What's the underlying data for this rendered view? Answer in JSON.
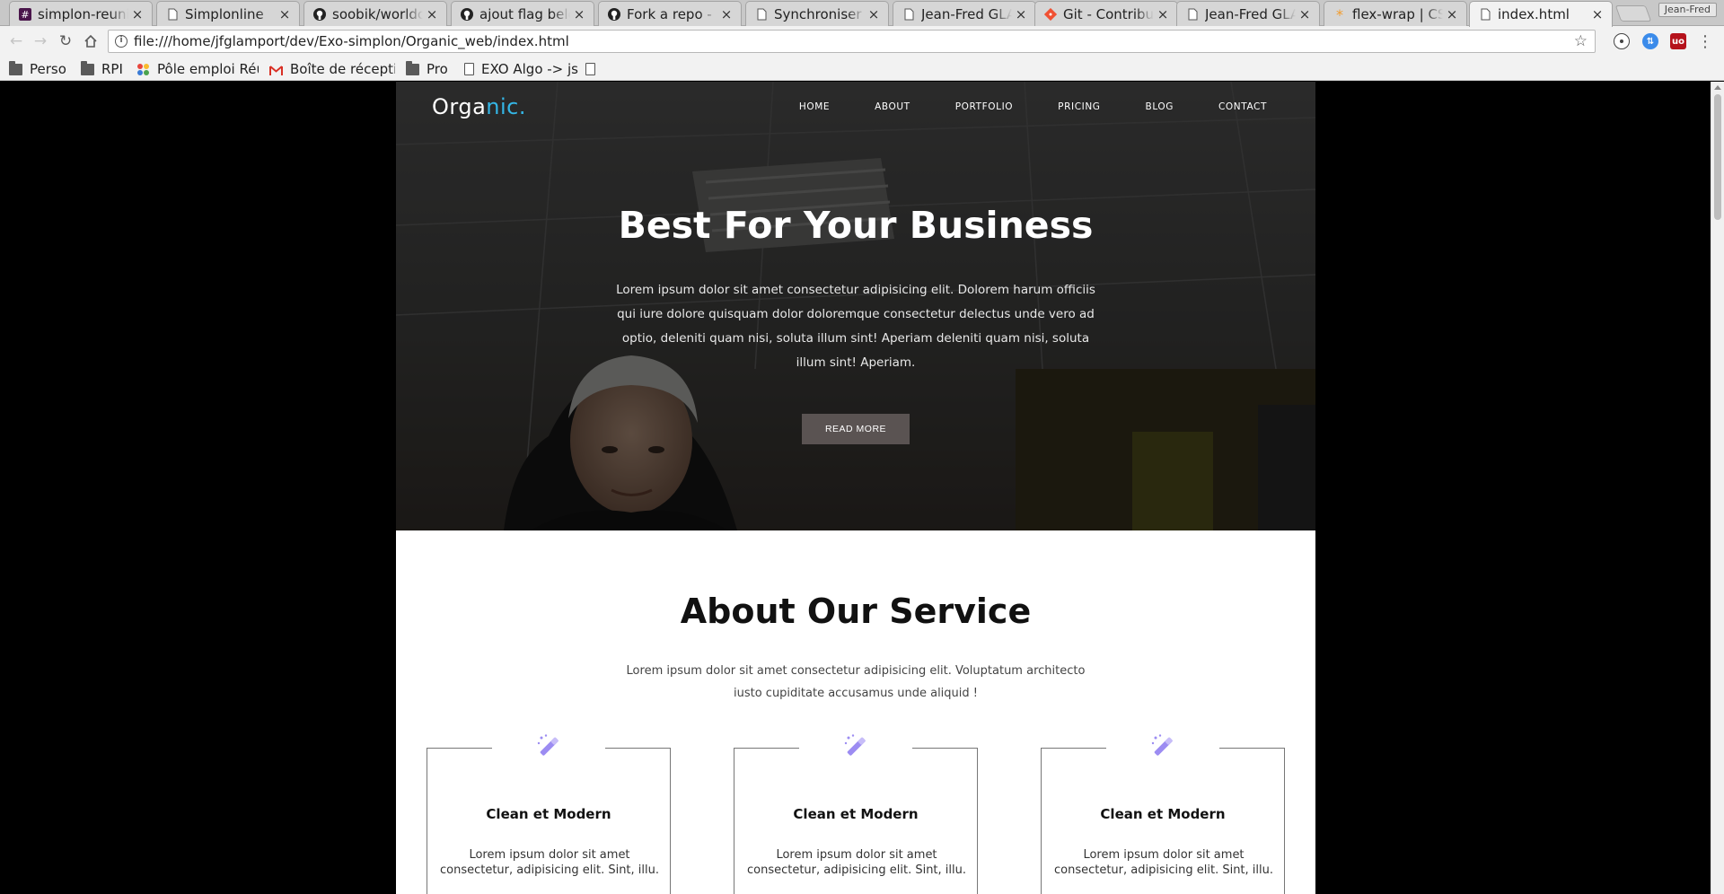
{
  "browser": {
    "tabs": [
      {
        "title": "simplon-reunion",
        "favicon": "slack-icon"
      },
      {
        "title": "Simplonline",
        "favicon": "page-icon"
      },
      {
        "title": "soobik/worldcountries",
        "favicon": "github-icon"
      },
      {
        "title": "ajout flag belgique",
        "favicon": "github-icon"
      },
      {
        "title": "Fork a repo - User Documentation",
        "favicon": "github-icon"
      },
      {
        "title": "Synchroniser son fork",
        "favicon": "page-icon"
      },
      {
        "title": "Jean-Fred GLAMPORT",
        "favicon": "page-icon"
      },
      {
        "title": "Git - Contributing",
        "favicon": "git-icon"
      },
      {
        "title": "Jean-Fred GLAMPORT",
        "favicon": "page-icon"
      },
      {
        "title": "flex-wrap | CSS-Tricks",
        "favicon": "csstricks-icon"
      },
      {
        "title": "index.html",
        "favicon": "page-icon",
        "active": true
      }
    ],
    "close_glyph": "×",
    "profile_name": "Jean-Fred",
    "url": "file:///home/jfglamport/dev/Exo-simplon/Organic_web/index.html",
    "bookmarks": [
      {
        "label": "Perso",
        "icon": "folder-icon"
      },
      {
        "label": "RPI",
        "icon": "folder-icon"
      },
      {
        "label": "Pôle emploi Réunion",
        "icon": "pinwheel-icon"
      },
      {
        "label": "Boîte de réception",
        "icon": "gmail-icon"
      },
      {
        "label": "Pro",
        "icon": "folder-icon"
      },
      {
        "label": "EXO Algo -> js",
        "icon": "page-icon"
      },
      {
        "label": "",
        "icon": "page-icon"
      }
    ]
  },
  "site": {
    "logo_main": "Orga",
    "logo_accent": "nic.",
    "nav": [
      "HOME",
      "ABOUT",
      "PORTFOLIO",
      "PRICING",
      "BLOG",
      "CONTACT"
    ],
    "hero": {
      "title": "Best For Your Business",
      "text": "Lorem ipsum dolor sit amet consectetur adipisicing elit. Dolorem harum officiis qui iure dolore quisquam dolor doloremque consectetur delectus unde vero ad optio, deleniti quam nisi, soluta illum sint! Aperiam deleniti quam nisi, soluta illum sint! Aperiam.",
      "button": "READ MORE"
    },
    "about": {
      "title": "About Our Service",
      "text": "Lorem ipsum dolor sit amet consectetur adipisicing elit. Voluptatum architecto iusto cupiditate accusamus unde aliquid !",
      "cards": [
        {
          "title": "Clean et Modern",
          "text": "Lorem ipsum dolor sit amet consectetur, adipisicing elit. Sint, illu.",
          "icon": "magic-wand-icon"
        },
        {
          "title": "Clean et Modern",
          "text": "Lorem ipsum dolor sit amet consectetur, adipisicing elit. Sint, illu.",
          "icon": "magic-wand-icon"
        },
        {
          "title": "Clean et Modern",
          "text": "Lorem ipsum dolor sit amet consectetur, adipisicing elit. Sint, illu.",
          "icon": "magic-wand-icon"
        }
      ]
    },
    "colors": {
      "accent": "#34b6e6",
      "button_bg": "#5a5352",
      "icon_color": "#9c8cf2"
    }
  }
}
